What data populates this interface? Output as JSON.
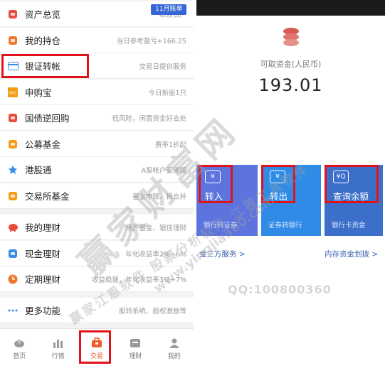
{
  "left": {
    "menu": [
      {
        "label": "资产总览",
        "sub": "综合资产",
        "icon": "wallet-icon",
        "color": "#e84c3d"
      },
      {
        "label": "我的持仓",
        "sub": "当日参考盈亏+166.25",
        "icon": "position-icon",
        "color": "#f0772e"
      },
      {
        "label": "银证转帐",
        "sub": "交易日提供服务",
        "icon": "card-icon",
        "color": "#3a8ee6"
      },
      {
        "label": "申购宝",
        "sub": "今日新股1只",
        "icon": "ipo-icon",
        "color": "#f39c12"
      },
      {
        "label": "国债逆回购",
        "sub": "低风险，闲置资金好去处",
        "icon": "bond-icon",
        "color": "#e84c3d"
      },
      {
        "label": "公募基金",
        "sub": "费率1折起",
        "icon": "fund-icon",
        "color": "#f39c12"
      },
      {
        "label": "港股通",
        "sub": "A股帐户买港股",
        "icon": "hk-icon",
        "color": "#3a8ee6"
      },
      {
        "label": "交易所基金",
        "sub": "基金申赎、拆合并",
        "icon": "exchange-fund-icon",
        "color": "#f39c12"
      },
      {
        "label": "我的理财",
        "sub": "场外基金、银信理财",
        "icon": "piggy-icon",
        "color": "#e84c3d"
      },
      {
        "label": "现金理财",
        "sub": "年化收益率2%~6%",
        "icon": "cash-icon",
        "color": "#3a8ee6"
      },
      {
        "label": "定期理财",
        "sub": "收益稳健，年化收益率3%~7%",
        "icon": "clock-icon",
        "color": "#f0772e"
      },
      {
        "label": "更多功能",
        "sub": "股转系统、股权激励等",
        "icon": "more-icon",
        "color": "#3a8ee6"
      }
    ],
    "badge": "11月账单",
    "nav": [
      {
        "label": "首页",
        "icon": "home-icon"
      },
      {
        "label": "行情",
        "icon": "market-icon"
      },
      {
        "label": "交易",
        "icon": "trade-icon"
      },
      {
        "label": "理财",
        "icon": "finance-icon"
      },
      {
        "label": "我的",
        "icon": "profile-icon"
      }
    ]
  },
  "right": {
    "avail_label": "可取资金(人民币)",
    "avail_value": "193.01",
    "cards": [
      {
        "title": "转入",
        "sub": "银行转证券",
        "icon_glyph": "¥",
        "color": "#5d74de"
      },
      {
        "title": "转出",
        "sub": "证券转银行",
        "icon_glyph": "¥",
        "color": "#2f8be6"
      },
      {
        "title": "查询余额",
        "sub": "银行卡资金",
        "icon_glyph": "¥Q",
        "color": "#3b6fc9"
      }
    ],
    "link_left": "金三方服务 >",
    "link_right": "内存资金划拨 >"
  },
  "watermarks": {
    "main": "赢家财富网",
    "sub": "赢家江恩软件  股票分析软件  江恩工具软件",
    "url": "www.yingjia360.com",
    "qq": "QQ:100800360"
  },
  "colors": {
    "highlight": "#e0131a",
    "accent": "#f05a28"
  }
}
